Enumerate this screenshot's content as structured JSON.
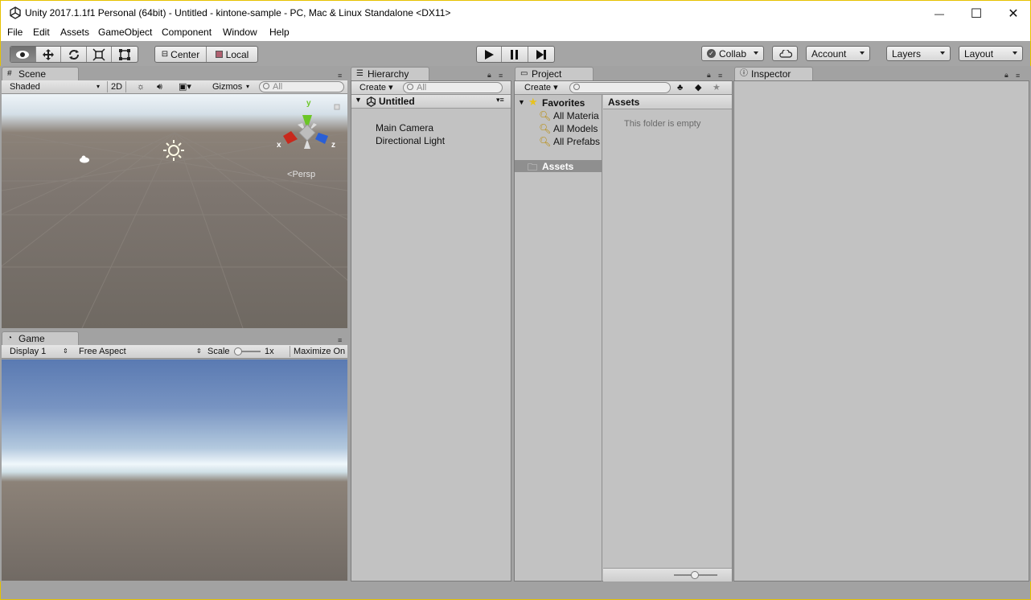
{
  "window": {
    "title": "Unity 2017.1.1f1 Personal (64bit) - Untitled - kintone-sample - PC, Mac & Linux Standalone <DX11>",
    "minimize_glyph": "—",
    "maximize_glyph": "☐",
    "close_glyph": "✕"
  },
  "menu": {
    "items": [
      "File",
      "Edit",
      "Assets",
      "GameObject",
      "Component",
      "Window",
      "Help"
    ]
  },
  "toolbar": {
    "center_label": "Center",
    "local_label": "Local",
    "collab_label": "Collab",
    "account_label": "Account",
    "layers_label": "Layers",
    "layout_label": "Layout"
  },
  "scene": {
    "tab_label": "Scene",
    "shading": "Shaded",
    "mode_2d": "2D",
    "gizmos": "Gizmos",
    "search_placeholder": "All",
    "persp_label": "Persp",
    "axis_x": "x",
    "axis_y": "y",
    "axis_z": "z"
  },
  "game": {
    "tab_label": "Game",
    "display": "Display 1",
    "aspect": "Free Aspect",
    "scale_label": "Scale",
    "scale_value": "1x",
    "maximize": "Maximize On"
  },
  "hierarchy": {
    "tab_label": "Hierarchy",
    "create_label": "Create",
    "search_placeholder": "All",
    "scene_name": "Untitled",
    "items": [
      "Main Camera",
      "Directional Light"
    ]
  },
  "project": {
    "tab_label": "Project",
    "create_label": "Create",
    "favorites_label": "Favorites",
    "favorites": [
      "All Materia",
      "All Models",
      "All Prefabs"
    ],
    "assets_folder": "Assets",
    "breadcrumb": "Assets",
    "empty_message": "This folder is empty"
  },
  "inspector": {
    "tab_label": "Inspector"
  },
  "colors": {
    "window_border": "#e6c200",
    "panel_bg": "#c2c2c2",
    "selected_row": "#8f8f8f"
  }
}
